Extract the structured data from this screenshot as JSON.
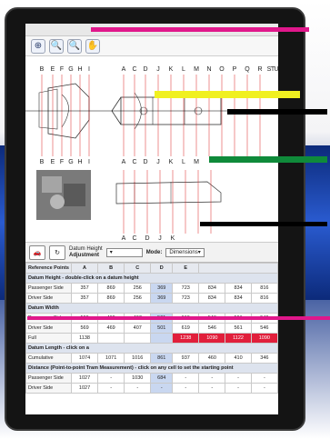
{
  "window": {
    "title": "",
    "controls": ""
  },
  "toolbar": {
    "tools": [
      {
        "name": "zoom-fit-tool",
        "glyph": "⊕"
      },
      {
        "name": "zoom-in-tool",
        "glyph": "🔍"
      },
      {
        "name": "zoom-out-tool",
        "glyph": "🔍"
      },
      {
        "name": "pan-tool",
        "glyph": "✋"
      }
    ]
  },
  "diagram": {
    "top_letters_left": [
      "B",
      "E",
      "F",
      "G",
      "H",
      "I"
    ],
    "top_letters_right": [
      "A",
      "C",
      "D",
      "J",
      "K",
      "L",
      "M",
      "N",
      "O",
      "P",
      "Q",
      "R",
      "S",
      "T",
      "U"
    ],
    "bottom_letters_left": [
      "B",
      "E",
      "F",
      "G",
      "H",
      "I"
    ],
    "bottom_letters_right": [
      "A",
      "C",
      "D",
      "J",
      "K",
      "L",
      "M"
    ],
    "lower_letters": [
      "A",
      "C",
      "D",
      "J",
      "K"
    ]
  },
  "controls": {
    "datum_label": "Datum Height",
    "adjustment_label": "Adjustment",
    "mode_label": "Mode:",
    "mode_value": "Dimensions"
  },
  "table": {
    "headers": [
      "Reference Points",
      "A",
      "B",
      "C",
      "D",
      "E",
      ""
    ],
    "sections": [
      {
        "title": "Datum Height - double-click on a datum height",
        "rows": [
          {
            "label": "Passenger Side",
            "cells": [
              "357",
              "869",
              "256",
              "369",
              "723",
              "834",
              "834",
              "816"
            ]
          },
          {
            "label": "Driver Side",
            "cells": [
              "357",
              "869",
              "256",
              "369",
              "723",
              "834",
              "834",
              "816"
            ]
          }
        ]
      },
      {
        "title": "Datum Width",
        "rows": [
          {
            "label": "Passenger Side",
            "cells": [
              "569",
              "469",
              "407",
              "501",
              "619",
              "546",
              "561",
              "546"
            ]
          },
          {
            "label": "Driver Side",
            "cells": [
              "569",
              "469",
              "407",
              "501",
              "619",
              "546",
              "561",
              "546"
            ]
          },
          {
            "label": "Full",
            "cells": [
              "1138",
              "",
              "",
              "",
              "1238",
              "1090",
              "1122",
              "1090"
            ]
          }
        ]
      },
      {
        "title": "Datum Length - click on a",
        "rows": [
          {
            "label": "Cumulative",
            "cells": [
              "1074",
              "1071",
              "1016",
              "861",
              "937",
              "460",
              "410",
              "346"
            ]
          }
        ]
      },
      {
        "title": "Distance (Point-to-point Tram Measurement) - click on any cell to set the starting point",
        "rows": [
          {
            "label": "Passenger Side",
            "cells": [
              "1027",
              "-",
              "1030",
              "684",
              "-",
              "-",
              "-",
              "-"
            ]
          },
          {
            "label": "Driver Side",
            "cells": [
              "1027",
              "-",
              "-",
              "-",
              "-",
              "-",
              "-",
              "-"
            ]
          }
        ]
      }
    ]
  },
  "colors": {
    "accent": "#2a5bd0",
    "highlight": "#c9d7f0",
    "alert": "#e11f3b"
  }
}
